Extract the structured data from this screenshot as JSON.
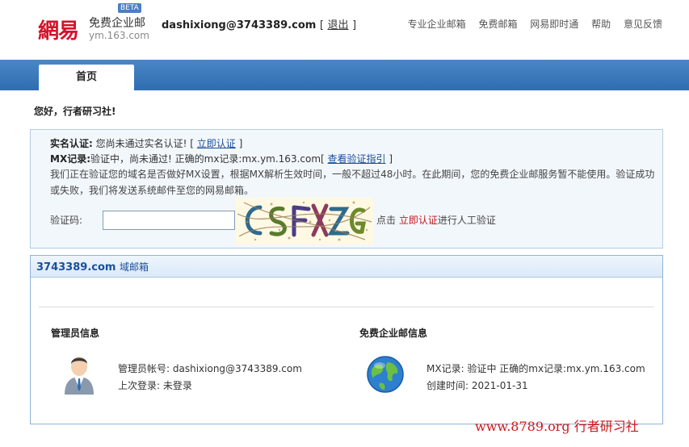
{
  "header": {
    "logo_mark": "網易",
    "logo_title": "免费企业邮",
    "logo_sub": "ym.163.com",
    "beta": "BETA",
    "user_email": "dashixiong@3743389.com",
    "bracket_open": "[",
    "logout": "退出",
    "bracket_close": "]",
    "nav": [
      "专业企业邮箱",
      "免费邮箱",
      "网易即时通",
      "帮助",
      "意见反馈"
    ]
  },
  "tabs": {
    "home": "首页"
  },
  "greeting": "您好，行者研习社!",
  "verify": {
    "realname_label": "实名认证:",
    "realname_text": "您尚未通过实名认证!",
    "realname_bracket_open": "[",
    "realname_link": "立即认证",
    "realname_bracket_close": "]",
    "mx_label": "MX记录:",
    "mx_text": "验证中，尚未通过! 正确的mx记录:mx.ym.163.com[",
    "mx_link": "查看验证指引",
    "mx_bracket_close": "]",
    "paragraph": "我们正在验证您的域名是否做好MX设置，根据MX解析生效时间，一般不超过48小时。在此期间，您的免费企业邮服务暂不能使用。验证成功或失败，我们将发送系统邮件至您的网易邮箱。",
    "captcha_label": "验证码:",
    "captcha_value": "",
    "hint_pre": "点击",
    "hint_link": "立即认证",
    "hint_post": "进行人工验证"
  },
  "domain": {
    "name": "3743389.com",
    "suffix": "域邮箱",
    "admin": {
      "title": "管理员信息",
      "account_label": "管理员帐号:",
      "account": "dashixiong@3743389.com",
      "last_login_label": "上次登录:",
      "last_login": "未登录"
    },
    "service": {
      "title": "免费企业邮信息",
      "mx_label": "MX记录:",
      "mx_value": "验证中 正确的mx记录:mx.ym.163.com",
      "created_label": "创建时间:",
      "created": "2021-01-31"
    }
  },
  "watermark": "www.8789.org 行者研习社",
  "colors": {
    "brand_red": "#d4122a",
    "band_blue": "#2f6db0",
    "link_blue": "#1a4f9c",
    "hint_red": "#c3161c"
  }
}
